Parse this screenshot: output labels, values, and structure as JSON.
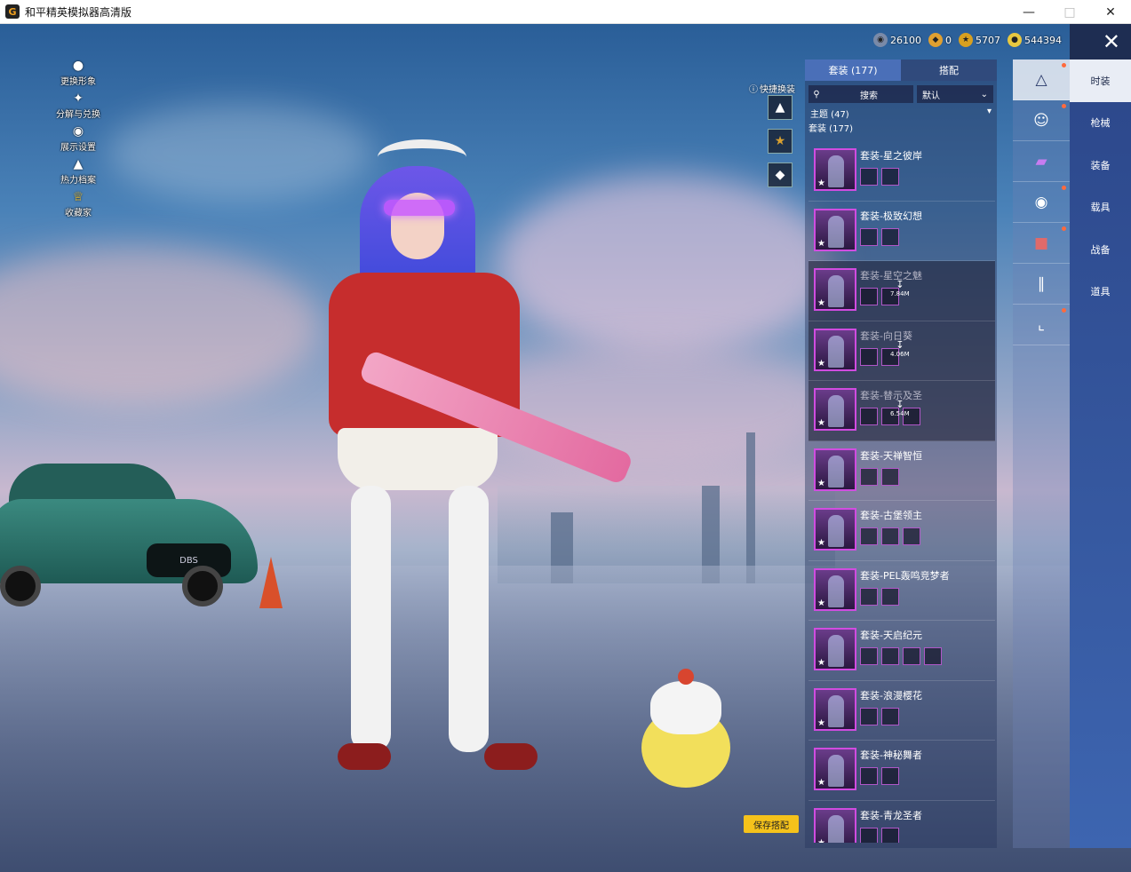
{
  "window": {
    "title": "和平精英模拟器高清版",
    "logo": "G",
    "controls": [
      "minimize-icon",
      "maximize-icon",
      "close-icon"
    ]
  },
  "left_menu": [
    {
      "label": "更换形象",
      "icon": "person-icon"
    },
    {
      "label": "分解与兑换",
      "icon": "puzzle-icon"
    },
    {
      "label": "展示设置",
      "icon": "eye-icon"
    },
    {
      "label": "热力档案",
      "icon": "flame-icon"
    },
    {
      "label": "收藏家",
      "icon": "crown-badge-icon"
    }
  ],
  "currencies": [
    {
      "icon": "coin-globe-icon",
      "value": "26100",
      "color": "#7a8aa8"
    },
    {
      "icon": "coupon-icon",
      "value": "0",
      "color": "#e0a030"
    },
    {
      "icon": "gold-coin-icon",
      "value": "5707",
      "color": "#d8a020"
    },
    {
      "icon": "uc-coin-icon",
      "value": "544394",
      "color": "#e8c840"
    }
  ],
  "quick_swap": {
    "label": "快捷换装",
    "slots": [
      "shirt-icon",
      "badge-icon",
      "diamond-icon"
    ]
  },
  "outfit_panel": {
    "tabs": [
      {
        "label": "套装 (177)",
        "active": true
      },
      {
        "label": "搭配",
        "active": false
      }
    ],
    "search_placeholder": "搜索",
    "sort_label": "默认",
    "theme_label": "主题 (47)",
    "set_count_label": "套装 (177)",
    "outfits": [
      {
        "name": "套装-星之彼岸",
        "parts": 2,
        "locked": false
      },
      {
        "name": "套装-极致幻想",
        "parts": 2,
        "locked": false
      },
      {
        "name": "套装-星空之魅",
        "parts": 2,
        "locked": true,
        "download": "7.84M"
      },
      {
        "name": "套装-向日葵",
        "parts": 2,
        "locked": true,
        "download": "4.06M"
      },
      {
        "name": "套装-替示及圣",
        "parts": 3,
        "locked": true,
        "download": "6.54M"
      },
      {
        "name": "套装-天禅智恒",
        "parts": 2,
        "locked": false
      },
      {
        "name": "套装-古堡领主",
        "parts": 3,
        "locked": false
      },
      {
        "name": "套装-PEL轰鸣竞梦者",
        "parts": 2,
        "locked": false
      },
      {
        "name": "套装-天启纪元",
        "parts": 4,
        "locked": false
      },
      {
        "name": "套装-浪漫樱花",
        "parts": 2,
        "locked": false
      },
      {
        "name": "套装-神秘舞者",
        "parts": 2,
        "locked": false
      },
      {
        "name": "套装-青龙圣者",
        "parts": 2,
        "locked": false
      }
    ]
  },
  "category_icons": [
    {
      "icon": "outfit-hat-icon",
      "active": true,
      "dot": true
    },
    {
      "icon": "character-icon",
      "active": false,
      "dot": true
    },
    {
      "icon": "cloth-piece-icon",
      "active": false,
      "dot": false
    },
    {
      "icon": "face-mask-icon",
      "active": false,
      "dot": true
    },
    {
      "icon": "top-clothing-icon",
      "active": false,
      "dot": true
    },
    {
      "icon": "pants-icon",
      "active": false,
      "dot": false
    },
    {
      "icon": "shoes-icon",
      "active": false,
      "dot": true
    }
  ],
  "right_nav": [
    {
      "label": "时装",
      "active": true
    },
    {
      "label": "枪械",
      "active": false
    },
    {
      "label": "装备",
      "active": false
    },
    {
      "label": "载具",
      "active": false
    },
    {
      "label": "战备",
      "active": false
    },
    {
      "label": "道具",
      "active": false
    }
  ],
  "save_button_label": "保存搭配",
  "car_plate": "DBS"
}
